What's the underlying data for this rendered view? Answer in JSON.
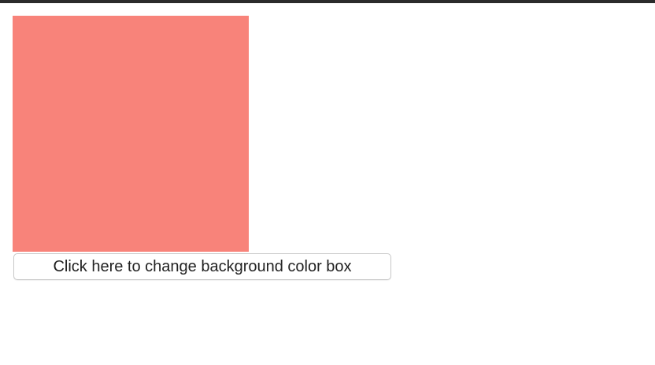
{
  "colors": {
    "box_background": "#f8837a",
    "window_top_border": "#2b2b2b"
  },
  "controls": {
    "change_color_button_label": "Click here to change background color box"
  }
}
